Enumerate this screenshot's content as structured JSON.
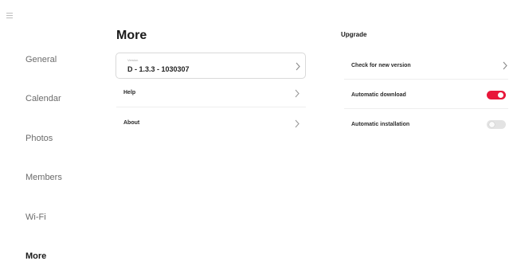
{
  "sidebar": {
    "menu_icon": "hamburger-menu-icon",
    "items": [
      {
        "label": "General"
      },
      {
        "label": "Calendar"
      },
      {
        "label": "Photos"
      },
      {
        "label": "Members"
      },
      {
        "label": "Wi-Fi"
      },
      {
        "label": "More",
        "active": true
      }
    ]
  },
  "more": {
    "title": "More",
    "version_caption": "Version",
    "version_value": "D - 1.3.3 - 1030307",
    "rows": [
      {
        "label": "Help",
        "icon": "chevron-right-icon"
      },
      {
        "label": "About",
        "icon": "chevron-right-icon"
      }
    ]
  },
  "upgrade": {
    "title": "Upgrade",
    "check_label": "Check for new version",
    "auto_download_label": "Automatic download",
    "auto_download_on": true,
    "auto_install_label": "Automatic installation",
    "auto_install_on": false
  },
  "colors": {
    "accent": "#e8173a",
    "toggle_off": "#e3e3e3",
    "text_primary": "#1a1a1a",
    "text_secondary": "#6b6b6b"
  }
}
